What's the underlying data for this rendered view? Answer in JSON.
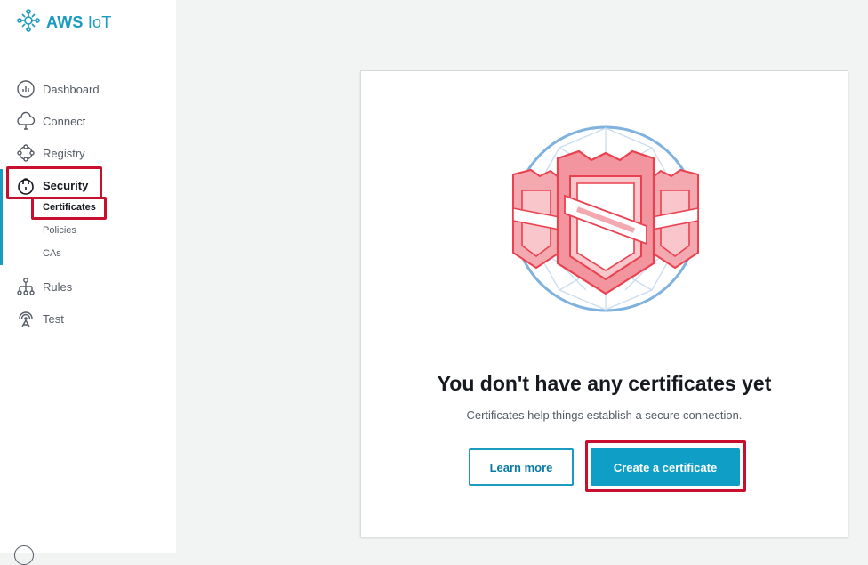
{
  "brand": {
    "name_bold": "AWS",
    "name_rest": "IoT"
  },
  "sidebar": {
    "items": [
      {
        "label": "Dashboard",
        "icon": "dashboard-icon"
      },
      {
        "label": "Connect",
        "icon": "cloud-connect-icon"
      },
      {
        "label": "Registry",
        "icon": "registry-icon"
      },
      {
        "label": "Security",
        "icon": "lock-icon",
        "active": true
      },
      {
        "label": "Rules",
        "icon": "rules-icon"
      },
      {
        "label": "Test",
        "icon": "test-icon"
      }
    ],
    "security_sub": [
      {
        "label": "Certificates",
        "active": true
      },
      {
        "label": "Policies"
      },
      {
        "label": "CAs"
      }
    ]
  },
  "main": {
    "empty_state": {
      "title": "You don't have any certificates yet",
      "subtitle": "Certificates help things establish a secure connection.",
      "learn_more_label": "Learn more",
      "create_label": "Create a certificate"
    }
  },
  "colors": {
    "accent": "#1a9bbf",
    "primary_button": "#0f9fc6",
    "highlight": "#c8102e",
    "shield": "#e9414f"
  }
}
